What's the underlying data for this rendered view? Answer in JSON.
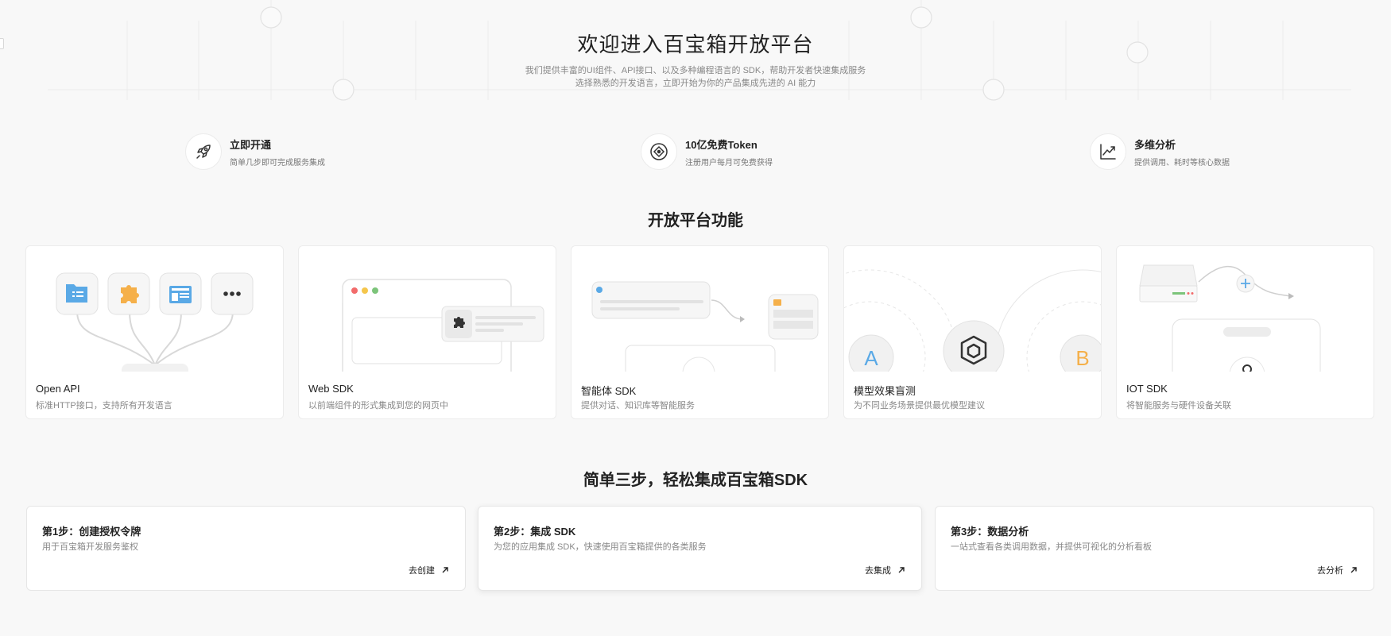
{
  "hero": {
    "title": "欢迎进入百宝箱开放平台",
    "subtitle_line1": "我们提供丰富的UI组件、API接口、以及多种编程语言的 SDK，帮助开发者快速集成服务",
    "subtitle_line2": "选择熟悉的开发语言，立即开始为你的产品集成先进的 AI 能力"
  },
  "features": [
    {
      "icon": "rocket-icon",
      "title": "立即开通",
      "desc": "简单几步即可完成服务集成"
    },
    {
      "icon": "token-icon",
      "title": "10亿免费Token",
      "desc": "注册用户每月可免费获得"
    },
    {
      "icon": "chart-icon",
      "title": "多维分析",
      "desc": "提供调用、耗时等核心数据"
    }
  ],
  "functions_title": "开放平台功能",
  "cards": [
    {
      "title": "Open API",
      "desc": "标准HTTP接口，支持所有开发语言"
    },
    {
      "title": "Web SDK",
      "desc": "以前端组件的形式集成到您的网页中"
    },
    {
      "title": "智能体 SDK",
      "desc": "提供对话、知识库等智能服务"
    },
    {
      "title": "模型效果盲测",
      "desc": "为不同业务场景提供最优模型建议",
      "letter_a": "A",
      "letter_b": "B"
    },
    {
      "title": "IOT SDK",
      "desc": "将智能服务与硬件设备关联"
    }
  ],
  "steps_title": "简单三步，轻松集成百宝箱SDK",
  "steps": [
    {
      "title": "第1步：创建授权令牌",
      "desc": "用于百宝箱开发服务鉴权",
      "action": "去创建"
    },
    {
      "title": "第2步：集成 SDK",
      "desc": "为您的应用集成 SDK，快速使用百宝箱提供的各类服务",
      "action": "去集成"
    },
    {
      "title": "第3步：数据分析",
      "desc": "一站式查看各类调用数据，并提供可视化的分析看板",
      "action": "去分析"
    }
  ],
  "colors": {
    "background": "#f8f8f8",
    "card_bg": "#ffffff",
    "accent_blue": "#5aa9e6",
    "accent_orange": "#f5b04a",
    "traffic_red": "#f26b6b",
    "traffic_yellow": "#f5c64c",
    "traffic_green": "#7cc47a"
  }
}
